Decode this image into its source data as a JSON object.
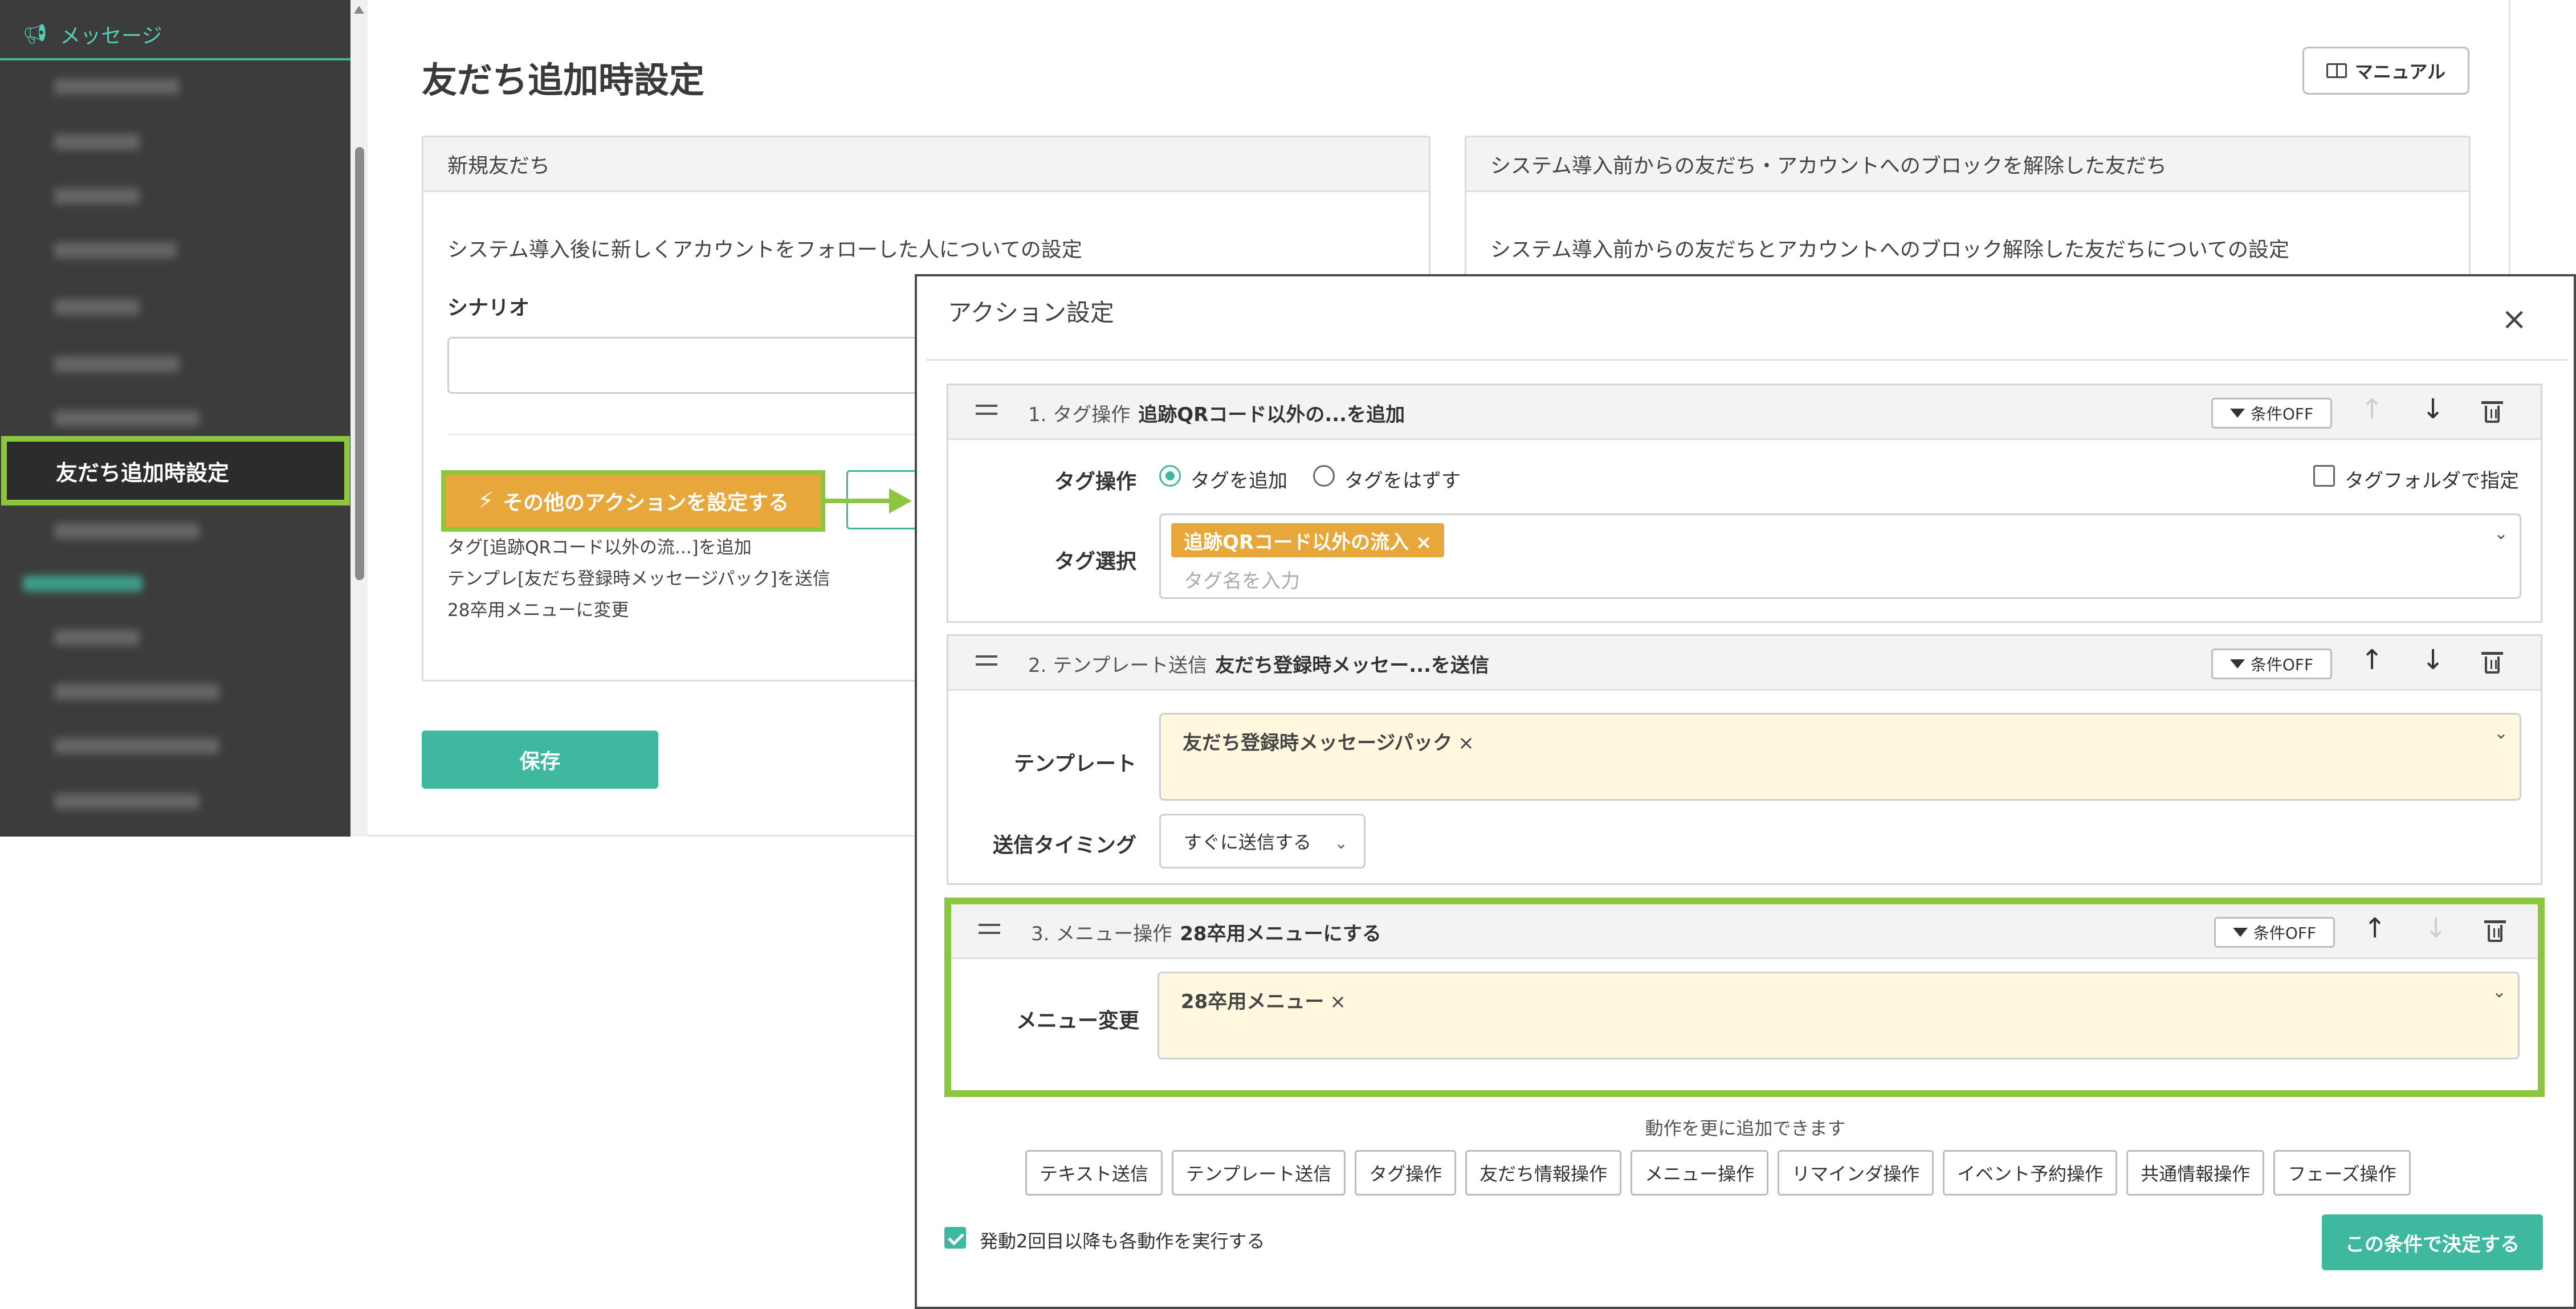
{
  "sidebar": {
    "section_label": "メッセージ",
    "active_item": "友だち追加時設定"
  },
  "page": {
    "title": "友だち追加時設定",
    "manual_label": "マニュアル",
    "save_label": "保存"
  },
  "cards": [
    {
      "header": "新規友だち",
      "description": "システム導入後に新しくアカウントをフォローした人についての設定",
      "scenario_label": "シナリオ",
      "other_action_label": "その他のアクションを設定する",
      "summary": [
        "タグ[追跡QRコード以外の流...]を追加",
        "テンプレ[友だち登録時メッセージパック]を送信",
        "28卒用メニューに変更"
      ]
    },
    {
      "header": "システム導入前からの友だち・アカウントへのブロックを解除した友だち",
      "description": "システム導入前からの友だちとアカウントへのブロック解除した友だちについての設定"
    }
  ],
  "modal": {
    "title": "アクション設定",
    "close_label": "×",
    "condition_label": "条件OFF",
    "steps": [
      {
        "number_type": "1. タグ操作",
        "summary": "追跡QRコード以外の...を追加",
        "tag_op_label": "タグ操作",
        "option_add": "タグを追加",
        "option_remove": "タグをはずす",
        "folder_label": "タグフォルダで指定",
        "tag_select_label": "タグ選択",
        "tag_chip": "追跡QRコード以外の流入 ×",
        "tag_placeholder": "タグ名を入力"
      },
      {
        "number_type": "2. テンプレート送信",
        "summary": "友だち登録時メッセー...を送信",
        "template_label": "テンプレート",
        "template_value": "友だち登録時メッセージパック",
        "timing_label": "送信タイミング",
        "timing_value": "すぐに送信する"
      },
      {
        "number_type": "3. メニュー操作",
        "summary": "28卒用メニューにする",
        "menu_label": "メニュー変更",
        "menu_value": "28卒用メニュー"
      }
    ],
    "add_caption": "動作を更に追加できます",
    "add_buttons": [
      "テキスト送信",
      "テンプレート送信",
      "タグ操作",
      "友だち情報操作",
      "メニュー操作",
      "リマインダ操作",
      "イベント予約操作",
      "共通情報操作",
      "フェーズ操作"
    ],
    "repeat_label": "発動2回目以降も各動作を実行する",
    "confirm_label": "この条件で決定する"
  },
  "colors": {
    "primary_teal": "#3fb8a0",
    "tag_orange": "#e8a73a",
    "highlight_green": "#8cc63f",
    "sidebar_bg": "#3c3c3c",
    "selected_field_bg": "#fff8de"
  },
  "icons": [
    "megaphone-icon",
    "book-icon",
    "bolt-icon",
    "close-icon",
    "drag-handle-icon",
    "funnel-icon",
    "arrow-up-icon",
    "arrow-down-icon",
    "trash-icon",
    "chevron-down-icon",
    "check-icon"
  ]
}
